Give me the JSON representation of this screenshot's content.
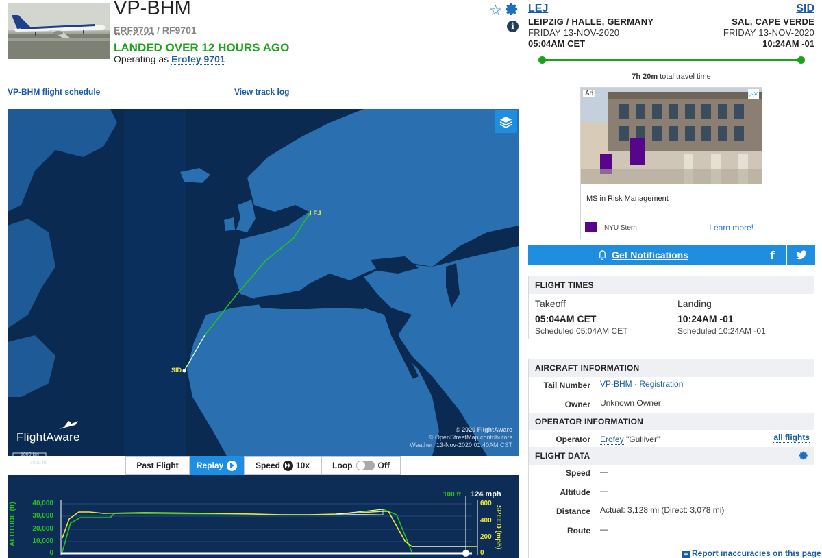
{
  "header": {
    "tail_number": "VP-BHM",
    "ident_primary": "ERF9701",
    "ident_separator": "/",
    "ident_secondary": "RF9701",
    "status": "LANDED OVER 12 HOURS AGO",
    "operating_prefix": "Operating as",
    "operating_callsign": "Erofey 9701"
  },
  "origin": {
    "code": "LEJ",
    "city": "LEIPZIG / HALLE, GERMANY",
    "date": "FRIDAY 13-NOV-2020",
    "time": "05:04AM CET"
  },
  "destination": {
    "code": "SID",
    "city": "SAL, CAPE VERDE",
    "date": "FRIDAY 13-NOV-2020",
    "time": "10:24AM -01"
  },
  "travel": {
    "duration": "7h 20m",
    "suffix": "total travel time"
  },
  "links": {
    "schedule": "VP-BHM flight schedule",
    "track_log": "View track log"
  },
  "map": {
    "origin_label": "LEJ",
    "dest_label": "SID",
    "logo_text": "FlightAware",
    "copyright_1": "© 2020 FlightAware",
    "copyright_2": "© OpenStreetMap contributors",
    "weather": "Weather: 13-Nov-2020 01:40AM CST",
    "scale_km": "1000 km",
    "scale_mi": "1000 mi",
    "colors": {
      "ocean": "#0a2a52",
      "land": "#2a6fb0",
      "route_flown": "#27c01f",
      "route_gap": "#ffffff"
    }
  },
  "toolbar": {
    "past_flight": "Past Flight",
    "replay": "Replay",
    "speed_label": "Speed",
    "speed_value": "10x",
    "loop_label": "Loop",
    "loop_value": "Off"
  },
  "graph": {
    "altitude_axis_label": "ALTITUDE (ft)",
    "speed_axis_label": "SPEED (mph)",
    "altitude_ticks": [
      "40,000",
      "30,000",
      "20,000",
      "10,000",
      "0"
    ],
    "speed_ticks": [
      "600",
      "400",
      "200",
      "0"
    ],
    "current_altitude": "100 ft",
    "current_speed": "124 mph",
    "colors": {
      "altitude": "#27c01f",
      "speed": "#e8e83a"
    }
  },
  "ad": {
    "badge": "Ad",
    "headline": "MS in Risk Management",
    "advertiser": "NYU Stern",
    "cta": "Learn more!"
  },
  "notifications": {
    "label": "Get Notifications",
    "facebook": "f",
    "twitter": "t"
  },
  "flight_times": {
    "title": "FLIGHT TIMES",
    "takeoff_label": "Takeoff",
    "takeoff_time": "05:04AM CET",
    "takeoff_scheduled": "Scheduled 05:04AM CET",
    "landing_label": "Landing",
    "landing_time": "10:24AM -01",
    "landing_scheduled": "Scheduled 10:24AM -01"
  },
  "aircraft": {
    "title": "AIRCRAFT INFORMATION",
    "tail_label": "Tail Number",
    "tail_value": "VP-BHM",
    "tail_sep": "·",
    "registration": "Registration",
    "owner_label": "Owner",
    "owner_value": "Unknown Owner"
  },
  "operator": {
    "title": "OPERATOR INFORMATION",
    "label": "Operator",
    "name": "Erofey",
    "nickname": "\"Gulliver\"",
    "all_flights": "all flights"
  },
  "flight_data": {
    "title": "FLIGHT DATA",
    "speed_label": "Speed",
    "speed_value": "—",
    "altitude_label": "Altitude",
    "altitude_value": "—",
    "distance_label": "Distance",
    "distance_value": "Actual: 3,128 mi (Direct: 3,078 mi)",
    "route_label": "Route",
    "route_value": "—"
  },
  "footer": {
    "report": "Report inaccuracies on this page"
  }
}
